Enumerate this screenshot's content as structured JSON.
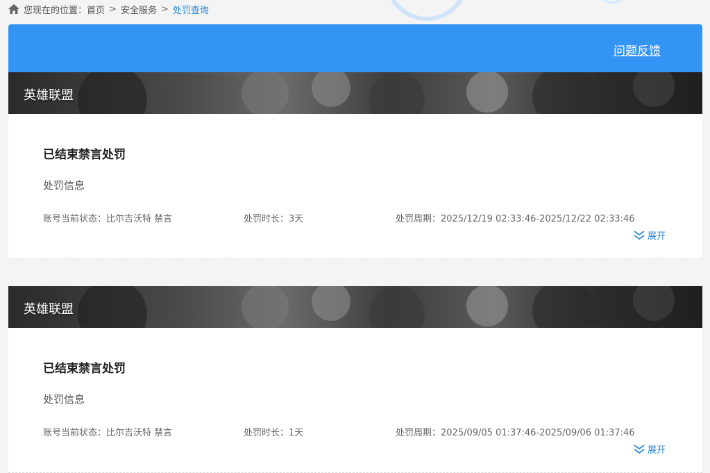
{
  "breadcrumb": {
    "prefix": "您现在的位置：",
    "items": [
      "首页",
      "安全服务",
      "处罚查询"
    ],
    "separator": ">"
  },
  "header": {
    "feedback_label": "问题反馈",
    "bg_color": "#3494f4"
  },
  "records": [
    {
      "game": "英雄联盟",
      "status": "已结束禁言处罚",
      "info_label": "处罚信息",
      "account_status": "账号当前状态：比尔吉沃特 禁言",
      "duration": "处罚时长：3天",
      "period": "处罚周期：2025/12/19 02:33:46-2025/12/22 02:33:46",
      "expand_label": "展开"
    },
    {
      "game": "英雄联盟",
      "status": "已结束禁言处罚",
      "info_label": "处罚信息",
      "account_status": "账号当前状态：比尔吉沃特 禁言",
      "duration": "处罚时长：1天",
      "period": "处罚周期：2025/09/05 01:37:46-2025/09/06 01:37:46",
      "expand_label": "展开"
    }
  ],
  "icons": {
    "home": "home-icon",
    "expand": "double-chevron-down-icon"
  },
  "colors": {
    "accent": "#2f88d6"
  }
}
